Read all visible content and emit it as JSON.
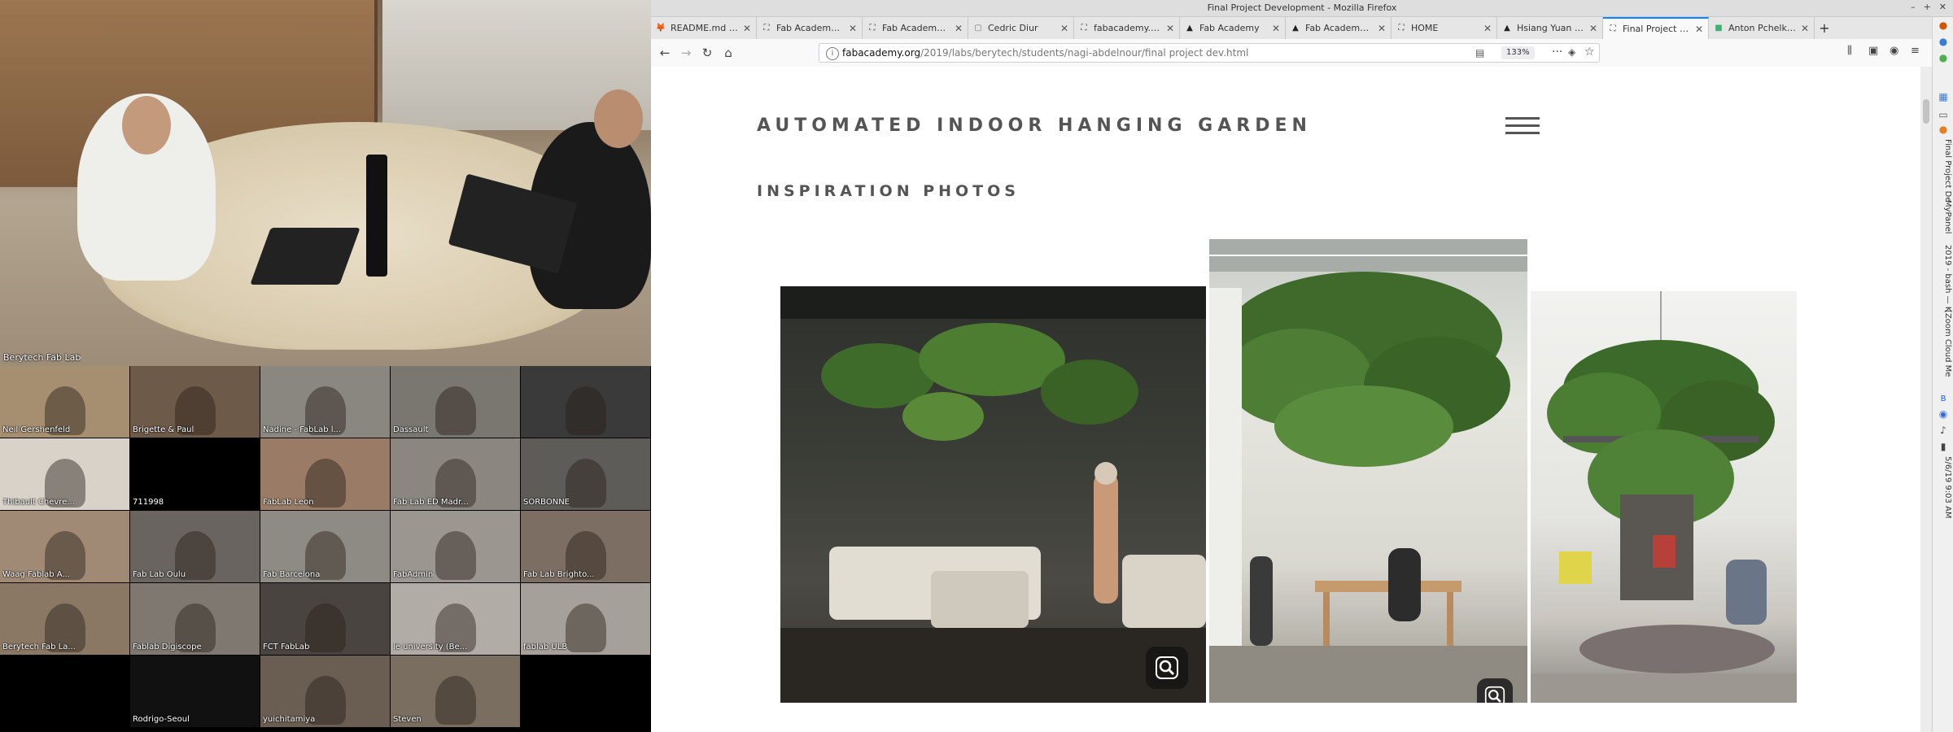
{
  "conference": {
    "main_label": "Berytech Fab Lab",
    "tiles": [
      {
        "label": "Neil Gershenfeld",
        "bg": "#a68e70"
      },
      {
        "label": "Brigette & Paul",
        "bg": "#6e5a48"
      },
      {
        "label": "Nadine - FabLab l...",
        "bg": "#8a8680"
      },
      {
        "label": "Dassault",
        "bg": "#7a7670"
      },
      {
        "label": "",
        "bg": "#3a3a3a"
      },
      {
        "label": "Thibault Chevre...",
        "bg": "#d8d2c8"
      },
      {
        "label": "711998",
        "bg": "#000000"
      },
      {
        "label": "FabLab Leon",
        "bg": "#9a7c66"
      },
      {
        "label": "Fab Lab ED Madr...",
        "bg": "#8c8680"
      },
      {
        "label": "SORBONNE",
        "bg": "#5e5c58"
      },
      {
        "label": "Waag Fablab A...",
        "bg": "#a08a76"
      },
      {
        "label": "Fab Lab Oulu",
        "bg": "#6a6460"
      },
      {
        "label": "Fab Barcelona",
        "bg": "#8e8a84"
      },
      {
        "label": "FabAdmin",
        "bg": "#9c9690"
      },
      {
        "label": "Fab Lab Brighto...",
        "bg": "#7c6e62"
      },
      {
        "label": "Berytech Fab La...",
        "bg": "#8a7864"
      },
      {
        "label": "Fablab Digiscope",
        "bg": "#7e7870"
      },
      {
        "label": "FCT FabLab",
        "bg": "#4a4440"
      },
      {
        "label": "ie university (Be...",
        "bg": "#b2aca6"
      },
      {
        "label": "fablab ULB",
        "bg": "#a6a09a"
      },
      {
        "label": "",
        "bg": "#000000"
      },
      {
        "label": "Rodrigo-Seoul",
        "bg": "#111111"
      },
      {
        "label": "yuichitamiya",
        "bg": "#6a5e52"
      },
      {
        "label": "Steven",
        "bg": "#7a6e60"
      },
      {
        "label": "",
        "bg": "#000000"
      }
    ]
  },
  "browser": {
    "window_title": "Final Project Development - Mozilla Firefox",
    "tabs": [
      {
        "title": "README.md · ma",
        "icon": "gitlab-icon"
      },
      {
        "title": "Fab Academy 20",
        "icon": "fab-icon"
      },
      {
        "title": "Fab Academy 20",
        "icon": "fab-icon"
      },
      {
        "title": "Cedric Diur",
        "icon": "page-icon"
      },
      {
        "title": "fabacademy.org/",
        "icon": "fab-icon"
      },
      {
        "title": "Fab Academy",
        "icon": "cap-icon"
      },
      {
        "title": "Fab Academy Re",
        "icon": "cap-icon"
      },
      {
        "title": "HOME",
        "icon": "fab-icon"
      },
      {
        "title": "Hsiang Yuan Ting",
        "icon": "cap-icon"
      },
      {
        "title": "Final Project Dev",
        "icon": "fab-icon",
        "selected": true
      },
      {
        "title": "Anton Pchelkin -",
        "icon": "green-square-icon"
      }
    ],
    "url": {
      "host": "fabacademy.org",
      "path": "/2019/labs/berytech/students/nagi-abdelnour/final project dev.html"
    },
    "zoom": "133%"
  },
  "page": {
    "site_title": "AUTOMATED INDOOR HANGING GARDEN",
    "section_heading": "INSPIRATION PHOTOS"
  },
  "sidebar_strip": {
    "labels": [
      "Final Project De",
      "MyPanel",
      "2019 - bash — K",
      "[Zoom Cloud Me"
    ],
    "clock": "5/6/19 9:03 AM"
  }
}
